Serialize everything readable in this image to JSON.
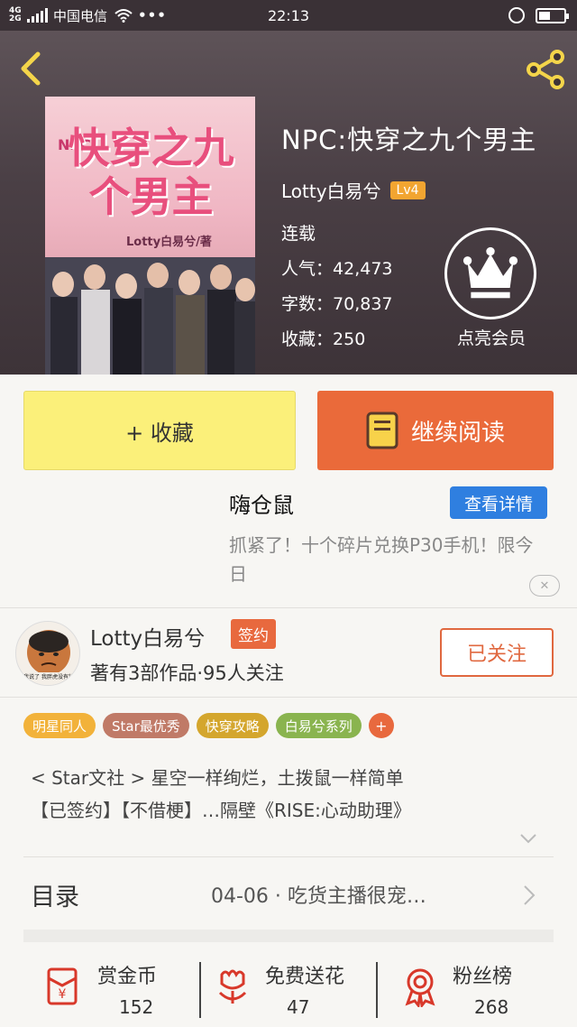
{
  "status_bar": {
    "network": "4G\n2G",
    "carrier": "中国电信",
    "more": "•••",
    "time": "22:13"
  },
  "header": {
    "cover": {
      "title": "快穿之九个男主",
      "prefix": "NPC:",
      "author": "Lotty白易兮/著"
    },
    "book_title": "NPC:快穿之九个男主",
    "author": "Lotty白易兮",
    "level": "Lv4",
    "status": "连载",
    "popularity_label": "人气：",
    "popularity": "42,473",
    "word_count_label": "字数：",
    "word_count": "70,837",
    "favorites_label": "收藏：",
    "favorites": "250",
    "vip_label": "点亮会员"
  },
  "actions": {
    "collect": "+ 收藏",
    "continue_reading": "继续阅读"
  },
  "ad": {
    "title": "嗨仓鼠",
    "button": "查看详情",
    "description": "抓紧了！十个碎片兑换P30手机！限今日",
    "close": "✕"
  },
  "author_info": {
    "name": "Lotty白易兮",
    "badge": "签约",
    "stats": "著有3部作品·95人关注",
    "follow_button": "已关注",
    "avatar_caption": "我说了 我胖虎没有钱"
  },
  "tags": [
    {
      "label": "明星同人",
      "color": "#f2b23a"
    },
    {
      "label": "Star最优秀",
      "color": "#c07a67"
    },
    {
      "label": "快穿攻略",
      "color": "#d4a62d"
    },
    {
      "label": "白易兮系列",
      "color": "#8ab44f"
    }
  ],
  "tag_add": "+",
  "intro": {
    "line1": "< Star文社 > 星空一样绚烂，土拨鼠一样简单",
    "line2": "【已签约】【不借梗】…隔壁《RISE:心动助理》"
  },
  "catalog": {
    "label": "目录",
    "latest": "04-06 · 吃货主播很宠…"
  },
  "bottom_stats": [
    {
      "label": "赏金币",
      "value": "152"
    },
    {
      "label": "免费送花",
      "value": "47"
    },
    {
      "label": "粉丝榜",
      "value": "268"
    }
  ]
}
